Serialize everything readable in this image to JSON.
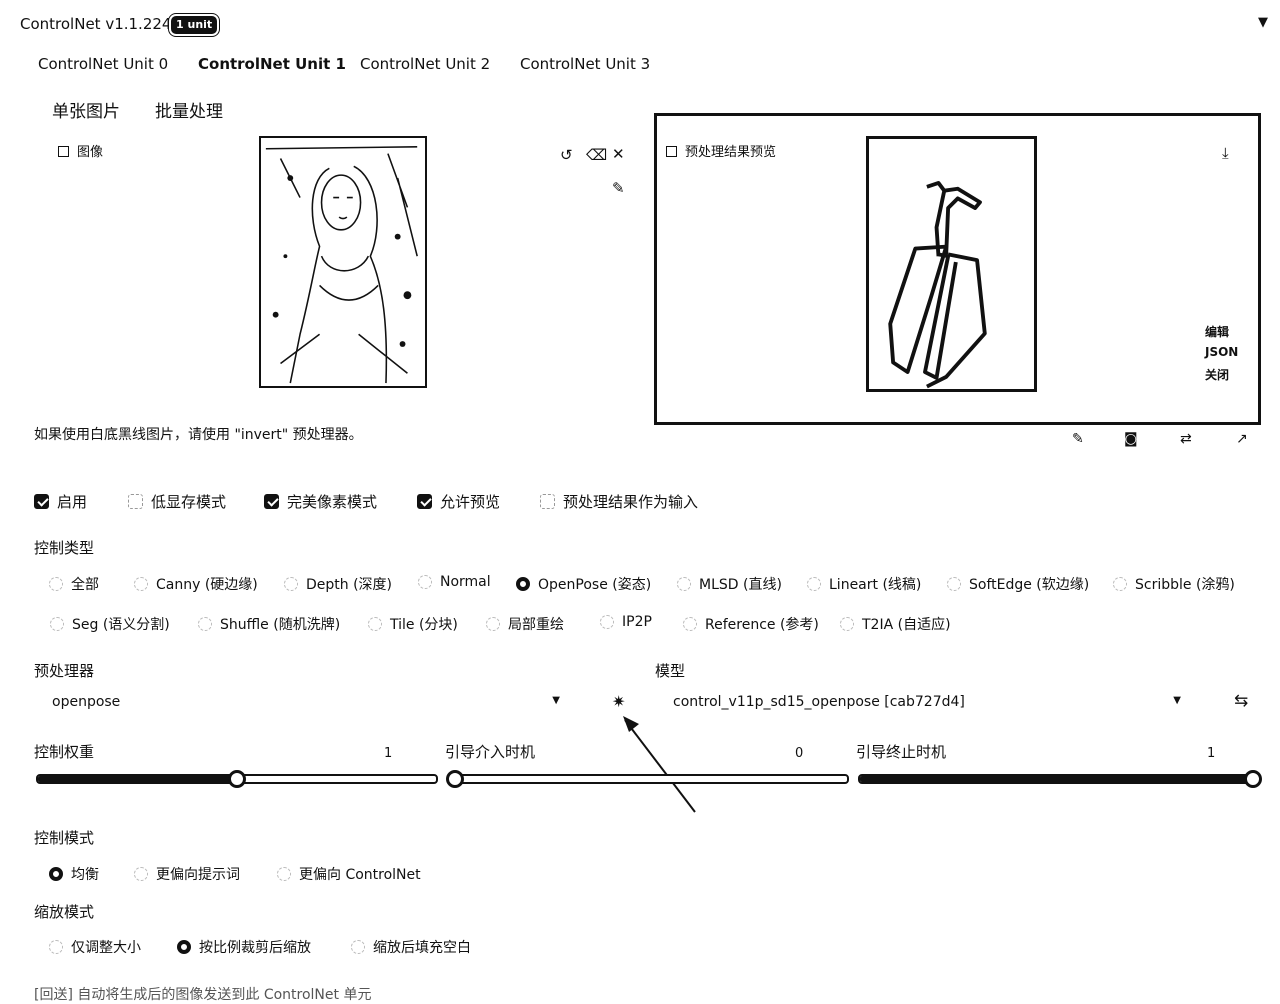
{
  "header": {
    "title": "ControlNet v1.1.224",
    "badge": "1 unit",
    "collapse_icon": "triangle-down-icon"
  },
  "unit_tabs": [
    "ControlNet Unit 0",
    "ControlNet Unit 1",
    "ControlNet Unit 2",
    "ControlNet Unit 3"
  ],
  "active_unit_tab": "ControlNet Unit 1",
  "mode_tabs": [
    "单张图片",
    "批量处理"
  ],
  "image_panel": {
    "label": "图像",
    "tools": [
      "undo-icon",
      "eraser-icon",
      "close-icon",
      "brush-icon"
    ]
  },
  "preview_panel": {
    "label": "预处理结果预览",
    "download_icon": "download-icon",
    "side_links": [
      "编辑",
      "JSON",
      "关闭"
    ],
    "toolbar_icons": [
      "edit-icon",
      "camera-icon",
      "swap-icon",
      "send-icon"
    ]
  },
  "note": "如果使用白底黑线图片，请使用 \"invert\" 预处理器。",
  "checkboxes": [
    {
      "label": "启用",
      "checked": true
    },
    {
      "label": "低显存模式",
      "checked": false
    },
    {
      "label": "完美像素模式",
      "checked": true
    },
    {
      "label": "允许预览",
      "checked": true
    },
    {
      "label": "预处理结果作为输入",
      "checked": false
    }
  ],
  "control_type": {
    "label": "控制类型",
    "row1": [
      "全部",
      "Canny (硬边缘)",
      "Depth (深度)",
      "Normal",
      "OpenPose (姿态)",
      "MLSD (直线)",
      "Lineart (线稿)",
      "SoftEdge (软边缘)",
      "Scribble (涂鸦)"
    ],
    "row2": [
      "Seg (语义分割)",
      "Shuffle (随机洗牌)",
      "Tile (分块)",
      "局部重绘",
      "IP2P",
      "Reference (参考)",
      "T2IA (自适应)"
    ],
    "selected": "OpenPose (姿态)"
  },
  "preprocessor": {
    "label": "预处理器",
    "value": "openpose",
    "run_icon": "explosion-icon"
  },
  "model": {
    "label": "模型",
    "value": "control_v11p_sd15_openpose [cab727d4]",
    "refresh_icon": "refresh-icon"
  },
  "sliders": [
    {
      "label": "控制权重",
      "value": "1",
      "fraction": 0.5
    },
    {
      "label": "引导介入时机",
      "value": "0",
      "fraction": 0.0
    },
    {
      "label": "引导终止时机",
      "value": "1",
      "fraction": 1.0
    }
  ],
  "control_mode": {
    "label": "控制模式",
    "options": [
      "均衡",
      "更偏向提示词",
      "更偏向 ControlNet"
    ],
    "selected": "均衡"
  },
  "resize_mode": {
    "label": "缩放模式",
    "options": [
      "仅调整大小",
      "按比例裁剪后缩放",
      "缩放后填充空白"
    ],
    "selected": "按比例裁剪后缩放"
  },
  "footer_partial": "[回送] 自动将生成后的图像发送到此 ControlNet 单元"
}
